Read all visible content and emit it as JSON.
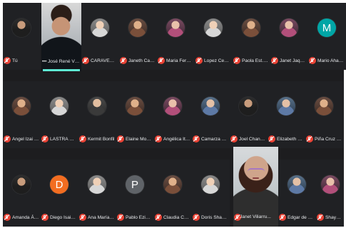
{
  "meeting": {
    "participants": [
      {
        "name": "Tú",
        "avatar": "photo-dark"
      },
      {
        "name": "José René VI...",
        "video": true
      },
      {
        "name": "CARAVEO HI...",
        "avatar": "photo-light"
      },
      {
        "name": "Janeth Cauich",
        "avatar": "photo-warm"
      },
      {
        "name": "Maria Fernan...",
        "avatar": "photo-pink"
      },
      {
        "name": "Lopez Ceped...",
        "avatar": "photo-light"
      },
      {
        "name": "Paola Est. Ag...",
        "avatar": "photo-warm"
      },
      {
        "name": "Janet Jaqueli...",
        "avatar": "photo-pink"
      },
      {
        "name": "Mario Aharon...",
        "initial": "M",
        "avatar_color": "#00a6a6"
      },
      {
        "name": "Angel Izai Cr...",
        "avatar": "photo-warm"
      },
      {
        "name": "LASTRA MEN...",
        "avatar": "photo-light"
      },
      {
        "name": "Kermit Bonfil",
        "avatar": "photo"
      },
      {
        "name": "Elaine Monse...",
        "avatar": "photo-warm"
      },
      {
        "name": "Angélica Itzel...",
        "avatar": "photo-pink"
      },
      {
        "name": "Camarza Cha...",
        "avatar": "photo-blue"
      },
      {
        "name": "Joel Chan Chi",
        "avatar": "photo-dark"
      },
      {
        "name": "Elizabeth Sua...",
        "avatar": "photo-blue"
      },
      {
        "name": "Piña Cruz Chr...",
        "avatar": "photo-warm"
      },
      {
        "name": "Amanda Álva...",
        "avatar": "photo-dark"
      },
      {
        "name": "Diego Isaih C...",
        "initial": "D",
        "avatar_color": "#f26d21"
      },
      {
        "name": "Ana María Fe...",
        "avatar": "photo-light"
      },
      {
        "name": "Pablo Eziubel...",
        "initial": "P",
        "avatar_color": "#5f6368"
      },
      {
        "name": "Claudia Conc...",
        "avatar": "photo-warm"
      },
      {
        "name": "Doris Shazel...",
        "avatar": "photo-light"
      },
      {
        "name": "Janet Viliarru...",
        "video": true
      },
      {
        "name": "Edgar de Jes...",
        "avatar": "photo-blue"
      },
      {
        "name": "Shayder Canc...",
        "avatar": "photo-pink"
      }
    ]
  }
}
